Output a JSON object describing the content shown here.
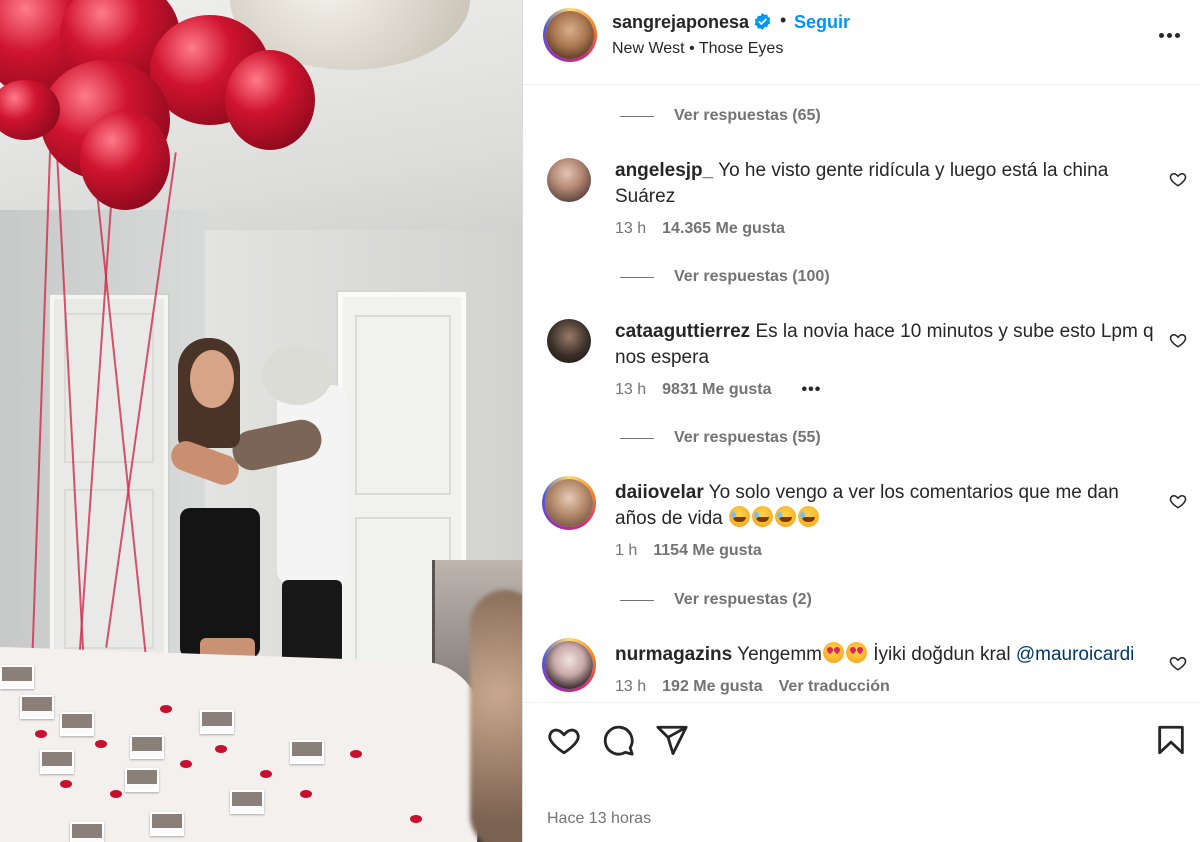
{
  "post": {
    "username": "sangrejaponesa",
    "follow_label": "Seguir",
    "separator": "•",
    "audio": {
      "artist": "New West",
      "song": "Those Eyes",
      "separator": "•"
    },
    "posted_ago": "Hace 13 horas",
    "verified": true
  },
  "comments": [
    {
      "type": "replies",
      "label": "Ver respuestas (65)"
    },
    {
      "type": "comment",
      "username": "angelesjp_",
      "text": "Yo he visto gente ridícula y luego está la china Suárez",
      "time": "13 h",
      "likes": "14.365 Me gusta",
      "story_ring": false
    },
    {
      "type": "replies",
      "label": "Ver respuestas (100)"
    },
    {
      "type": "comment",
      "username": "cataaguttierrez",
      "text": "Es la novia hace 10 minutos y sube esto Lpm q nos espera",
      "time": "13 h",
      "likes": "9831 Me gusta",
      "more": "•••",
      "story_ring": false
    },
    {
      "type": "replies",
      "label": "Ver respuestas (55)"
    },
    {
      "type": "comment",
      "username": "daiiovelar",
      "text": "Yo solo vengo a ver los comentarios que me dan años de vida",
      "emoji": [
        "rolling-on-floor-laughing",
        "rolling-on-floor-laughing",
        "rolling-on-floor-laughing",
        "rolling-on-floor-laughing"
      ],
      "time": "1 h",
      "likes": "1154 Me gusta",
      "story_ring": true
    },
    {
      "type": "replies",
      "label": "Ver respuestas (2)"
    },
    {
      "type": "comment",
      "username": "nurmagazins",
      "text_before": "Yengemm",
      "emoji": [
        "smiling-face-with-heart-eyes",
        "smiling-face-with-heart-eyes"
      ],
      "text_after": " İyiki doğdun kral ",
      "mention": "@mauroicardi",
      "time": "13 h",
      "likes": "192 Me gusta",
      "translate": "Ver traducción",
      "story_ring": true
    }
  ],
  "actions": {
    "icons": [
      "heart-outline-icon",
      "comment-icon",
      "share-paper-plane-icon",
      "bookmark-icon"
    ]
  },
  "colors": {
    "link_blue": "#0095f6",
    "text": "#262626",
    "secondary": "#737373",
    "mention": "#00376b",
    "verified_blue": "#0095f6"
  }
}
